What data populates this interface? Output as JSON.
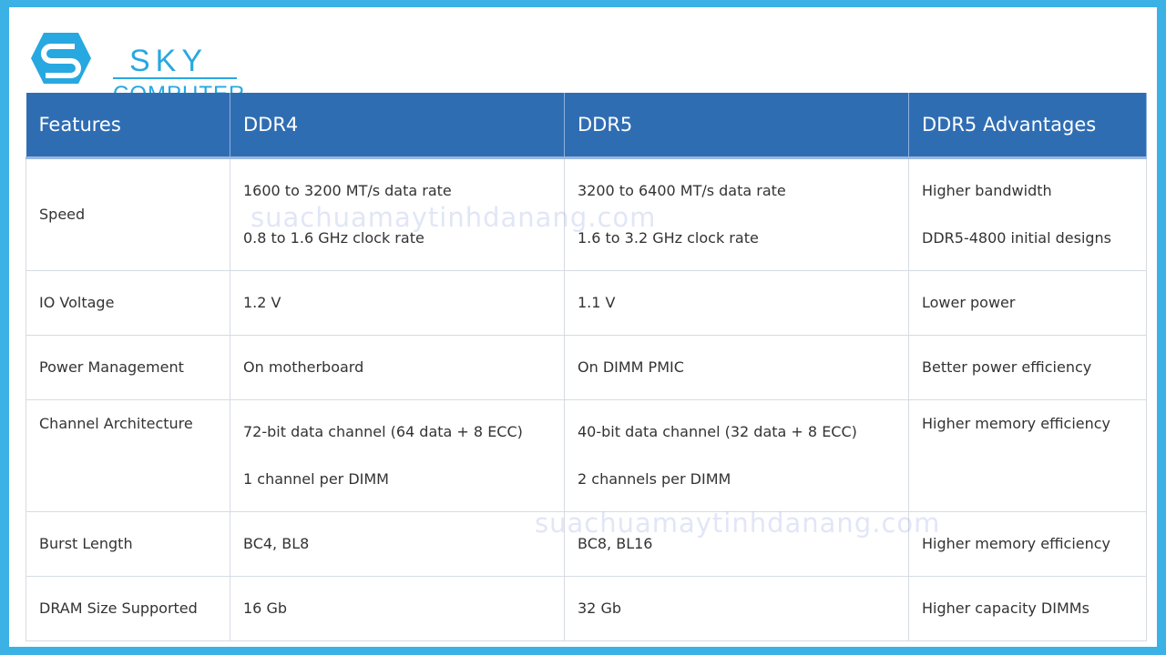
{
  "logo": {
    "line1": "SKY",
    "line2": "COMPUTER"
  },
  "table": {
    "headers": [
      "Features",
      "DDR4",
      "DDR5",
      "DDR5 Advantages"
    ],
    "rows": [
      {
        "feature": "Speed",
        "ddr4": [
          "1600 to 3200 MT/s data rate",
          "0.8 to 1.6 GHz clock rate"
        ],
        "ddr5": [
          "3200 to 6400 MT/s data rate",
          "1.6 to 3.2 GHz clock rate"
        ],
        "adv": [
          "Higher bandwidth",
          "DDR5-4800 initial designs"
        ]
      },
      {
        "feature": "IO Voltage",
        "ddr4": [
          "1.2 V"
        ],
        "ddr5": [
          "1.1 V"
        ],
        "adv": [
          "Lower power"
        ]
      },
      {
        "feature": "Power Management",
        "ddr4": [
          "On motherboard"
        ],
        "ddr5": [
          "On DIMM PMIC"
        ],
        "adv": [
          "Better power efficiency"
        ]
      },
      {
        "feature": "Channel Architecture",
        "ddr4": [
          "72-bit data channel (64 data + 8 ECC)",
          "1 channel per DIMM"
        ],
        "ddr5": [
          "40-bit data channel (32 data + 8 ECC)",
          "2 channels per DIMM"
        ],
        "adv": [
          "Higher memory efficiency"
        ]
      },
      {
        "feature": "Burst Length",
        "ddr4": [
          "BC4, BL8"
        ],
        "ddr5": [
          "BC8, BL16"
        ],
        "adv": [
          "Higher memory efficiency"
        ]
      },
      {
        "feature": "DRAM Size Supported",
        "ddr4": [
          "16 Gb"
        ],
        "ddr5": [
          "32 Gb"
        ],
        "adv": [
          "Higher capacity DIMMs"
        ]
      }
    ]
  },
  "watermark": "suachuamaytinhdanang.com"
}
